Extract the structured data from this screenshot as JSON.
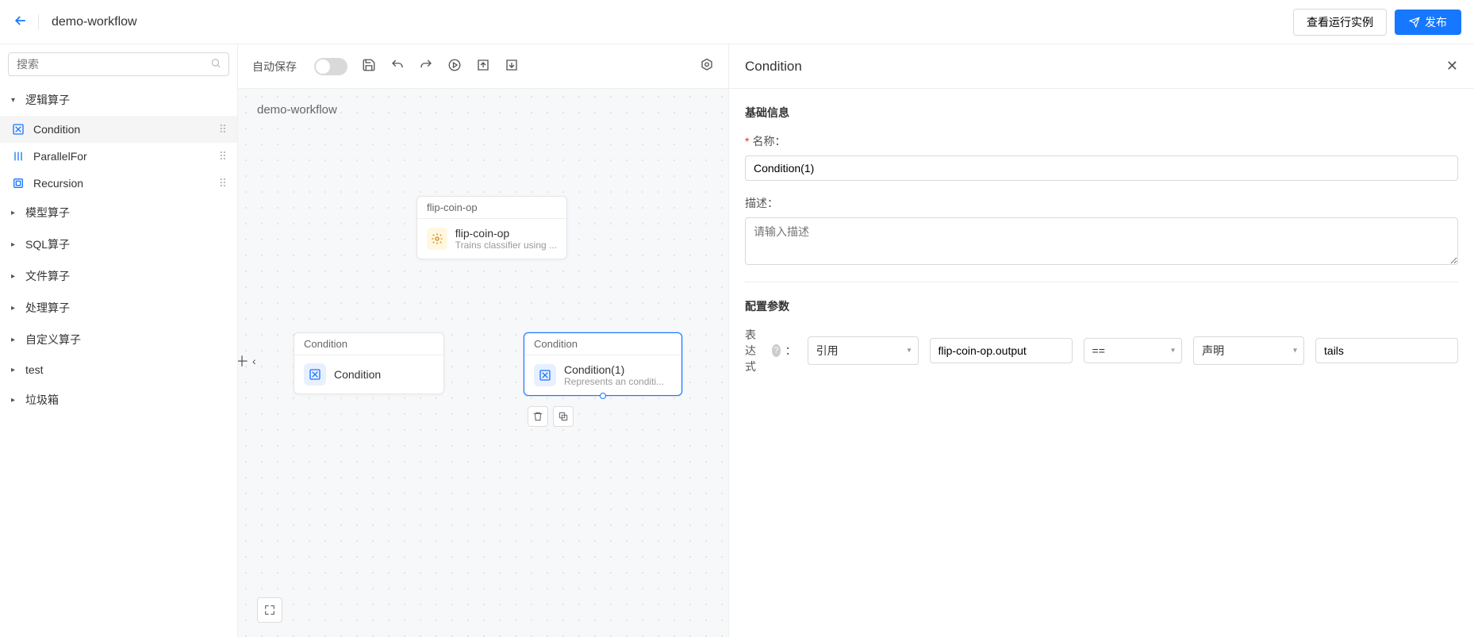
{
  "header": {
    "workflow_title": "demo-workflow",
    "view_instances_label": "查看运行实例",
    "publish_label": "发布"
  },
  "sidebar": {
    "search_placeholder": "搜索",
    "groups": [
      {
        "label": "逻辑算子",
        "expanded": true
      },
      {
        "label": "模型算子",
        "expanded": false
      },
      {
        "label": "SQL算子",
        "expanded": false
      },
      {
        "label": "文件算子",
        "expanded": false
      },
      {
        "label": "处理算子",
        "expanded": false
      },
      {
        "label": "自定义算子",
        "expanded": false
      },
      {
        "label": "test",
        "expanded": false
      },
      {
        "label": "垃圾箱",
        "expanded": false
      }
    ],
    "logic_items": [
      {
        "label": "Condition"
      },
      {
        "label": "ParallelFor"
      },
      {
        "label": "Recursion"
      }
    ]
  },
  "toolbar": {
    "autosave_label": "自动保存"
  },
  "canvas": {
    "title": "demo-workflow",
    "nodes": {
      "flip": {
        "header": "flip-coin-op",
        "title": "flip-coin-op",
        "sub": "Trains classifier using ..."
      },
      "cond_left": {
        "header": "Condition",
        "title": "Condition"
      },
      "cond_right": {
        "header": "Condition",
        "title": "Condition(1)",
        "sub": "Represents an conditi..."
      }
    }
  },
  "panel": {
    "title": "Condition",
    "section_basic": "基础信息",
    "name_label": "名称：",
    "name_value": "Condition(1)",
    "desc_label": "描述：",
    "desc_placeholder": "请输入描述",
    "section_params": "配置参数",
    "expr_label": "表达式",
    "expr": {
      "left_mode": "引用",
      "left_value": "flip-coin-op.output",
      "operator": "==",
      "right_mode": "声明",
      "right_value": "tails"
    }
  }
}
